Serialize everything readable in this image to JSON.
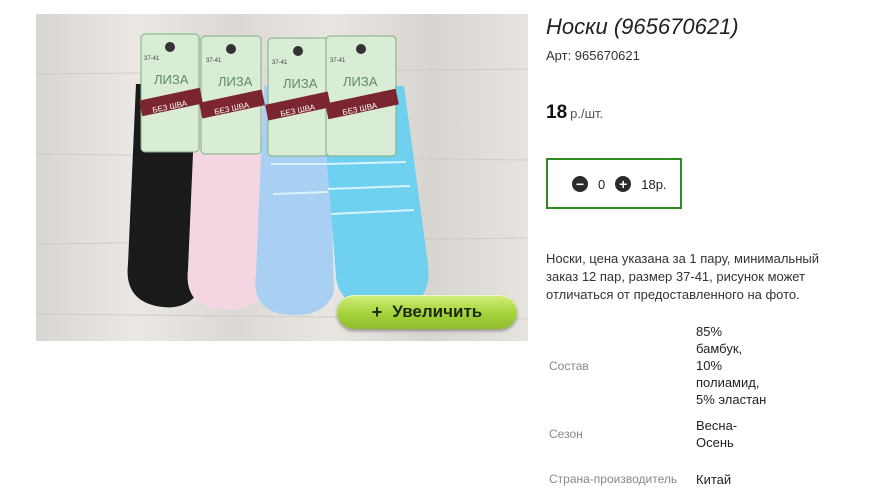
{
  "product": {
    "title": "Носки (965670621)",
    "sku": "Арт: 965670621",
    "price_value": "18",
    "price_unit": "р./шт.",
    "description": "Носки, цена указана за 1 пару, минимальный заказ 12 пар, размер 37-41, рисунок может отличаться от предоставленного на фото."
  },
  "gallery": {
    "zoom_icon": "+",
    "zoom_label": "Увеличить",
    "photo_texts": {
      "brand": "ЛИЗА",
      "feature": "БЕЗ ШВА",
      "size": "37-41"
    }
  },
  "quantity": {
    "minus_icon": "minus-circle-icon",
    "plus_icon": "plus-circle-icon",
    "value": "0",
    "sum": "18р."
  },
  "specs": [
    {
      "label": "Состав",
      "lines": [
        "85%",
        "бамбук,",
        "10%",
        "полиамид,",
        "5% эластан"
      ]
    },
    {
      "label": "Сезон",
      "lines": [
        "Весна-",
        "Осень"
      ]
    },
    {
      "label": "Страна-производитель",
      "lines": [
        "Китай"
      ]
    }
  ],
  "colors": {
    "qty_border": "#2e8b22",
    "zoom_button": "#a4d23c",
    "sock_colors": [
      "#1a1a1a",
      "#f4d6e3",
      "#a9cff3",
      "#6fd0f0"
    ]
  }
}
